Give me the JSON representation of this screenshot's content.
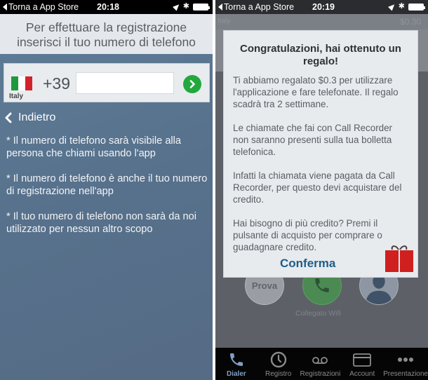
{
  "left_screen": {
    "status_bar": {
      "back_label": "Torna a App Store",
      "time": "20:18",
      "icons": [
        "location-icon",
        "bluetooth-icon",
        "battery-icon"
      ]
    },
    "header": {
      "line1": "Per effettuare la registrazione",
      "line2": "inserisci il tuo numero di telefono"
    },
    "phone_entry": {
      "country": "Italy",
      "flag_colors": [
        "#1e9a3c",
        "#ffffff",
        "#d2232c"
      ],
      "prefix": "+39",
      "phone_value": "",
      "phone_placeholder": "",
      "submit_icon": "chevron-right-icon",
      "submit_color": "#23a83d"
    },
    "back_link": "Indietro",
    "notes": [
      "* Il numero di telefono sarà visibile alla persona che chiami usando l'app",
      "* Il numero di telefono è anche il tuo numero di registrazione nell'app",
      "* Il tuo numero di telefono non sarà da noi utilizzato per nessun altro scopo"
    ]
  },
  "right_screen": {
    "status_bar": {
      "back_label": "Torna a App Store",
      "time": "20:19",
      "icons": [
        "location-icon",
        "bluetooth-icon",
        "battery-icon"
      ]
    },
    "top_bar": {
      "country": "Italy",
      "balance": "$0.30"
    },
    "dialog": {
      "title": "Congratulazioni, hai ottenuto un regalo!",
      "paragraphs": [
        "Ti abbiamo regalato $0.3 per utilizzare l'applicazione e fare telefonate. Il regalo scadrà tra 2 settimane.",
        "Le chiamate che fai con Call Recorder non saranno presenti sulla tua bolletta telefonica.",
        "Infatti la chiamata viene pagata da Call Recorder, per questo devi acquistare del credito.",
        "Hai bisogno di più credito? Premi il pulsante di acquisto per comprare o guadagnare credito."
      ],
      "confirm_label": "Conferma",
      "gift_icon": "gift-icon"
    },
    "dialer": {
      "test_button": "Prova",
      "call_icon": "phone-icon",
      "contact_icon": "contact-icon",
      "connection_status": "Collegato Wifi"
    },
    "tab_bar": {
      "active_color": "#7f9fc4",
      "tabs": [
        {
          "label": "Dialer",
          "icon": "phone-icon",
          "active": true
        },
        {
          "label": "Registro",
          "icon": "clock-icon",
          "active": false
        },
        {
          "label": "Registrazioni",
          "icon": "voicemail-icon",
          "active": false
        },
        {
          "label": "Account",
          "icon": "credit-card-icon",
          "active": false
        },
        {
          "label": "Presentazione",
          "icon": "more-dots-icon",
          "active": false
        }
      ]
    }
  }
}
